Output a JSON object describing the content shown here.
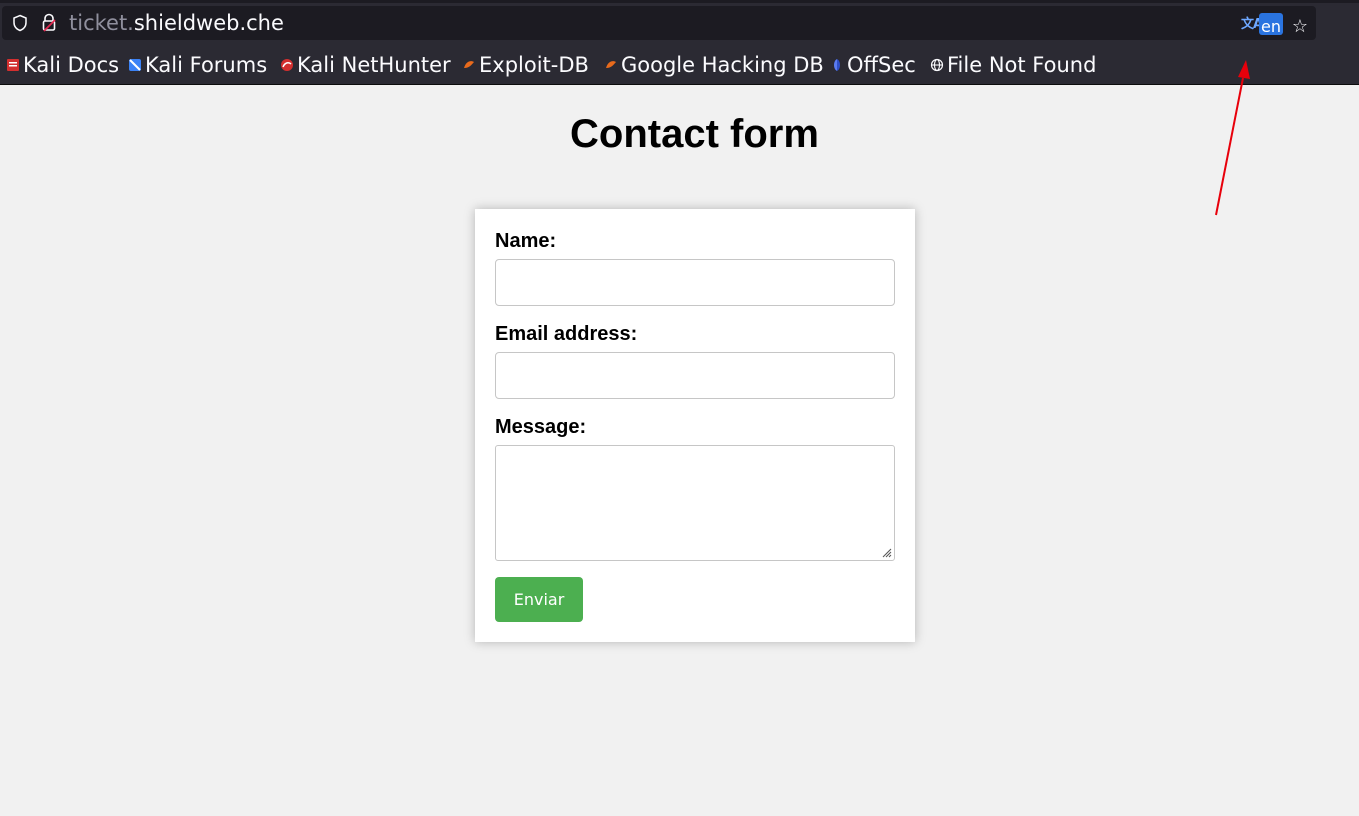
{
  "browser": {
    "url_subdomain": "ticket.",
    "url_domain": "shieldweb.che",
    "translate_glyph": "文A",
    "translate_lang": "en",
    "star_icon": "☆",
    "bookmarks": [
      {
        "label": "Kali Docs",
        "icon": "kali-docs-icon",
        "color": "#d32f2f"
      },
      {
        "label": "Kali Forums",
        "icon": "kali-forums-icon",
        "color": "#3b82f6"
      },
      {
        "label": "Kali NetHunter",
        "icon": "kali-nethunter-icon",
        "color": "#d32f2f"
      },
      {
        "label": "Exploit-DB",
        "icon": "exploit-db-icon",
        "color": "#e86a1c"
      },
      {
        "label": "Google Hacking DB",
        "icon": "ghdb-icon",
        "color": "#e86a1c"
      },
      {
        "label": "OffSec",
        "icon": "offsec-icon",
        "color": "#5b7cf0"
      },
      {
        "label": "File Not Found",
        "icon": "globe-icon",
        "color": "#fbfbfe"
      }
    ]
  },
  "page": {
    "title": "Contact form",
    "form": {
      "name_label": "Name:",
      "name_value": "",
      "email_label": "Email address:",
      "email_value": "",
      "message_label": "Message:",
      "message_value": "",
      "submit_label": "Enviar"
    }
  },
  "colors": {
    "submit_button": "#4caf50",
    "annotation_arrow": "#e8000b",
    "translate_badge": "#2a74e0"
  }
}
